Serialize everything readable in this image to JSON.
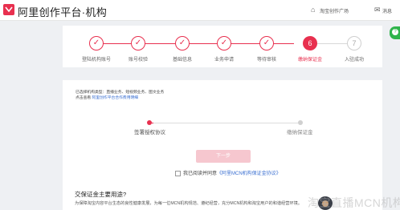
{
  "header": {
    "title": "阿里创作平台·机构",
    "links": [
      "淘宝创作广场",
      "消息"
    ],
    "brand_color": "#e8304f"
  },
  "steps": [
    {
      "label": "登陆机构账号",
      "mark": "✓",
      "state": "done"
    },
    {
      "label": "账号校验",
      "mark": "✓",
      "state": "done"
    },
    {
      "label": "基础信息",
      "mark": "✓",
      "state": "done"
    },
    {
      "label": "业务申请",
      "mark": "✓",
      "state": "done"
    },
    {
      "label": "等待审核",
      "mark": "✓",
      "state": "done"
    },
    {
      "label": "缴纳保证金",
      "mark": "6",
      "state": "active"
    },
    {
      "label": "入驻成功",
      "mark": "7",
      "state": "pending"
    }
  ],
  "main": {
    "selected_types": "已选择机构类型：直播业务、短视频业务、图文业务",
    "view_prefix": "点击查看 ",
    "view_link": "阿里创作平台合作费用明细",
    "substeps": [
      "签署授权协议",
      "缴纳保证金"
    ],
    "next_button": "下一步",
    "agree_text": "我已阅读并同意",
    "agreement_link": "《阿里MCN机构保证金协议》",
    "faq_title": "交保证金主要用途?",
    "faq_text": "为保障淘宝内容平台生态的良性健康发展，为每一位MCN机构规范、遵纪经营，充分MCN机构和淘宝用户的和谐经营环境。"
  },
  "watermark": "淘宝直播MCN机构"
}
